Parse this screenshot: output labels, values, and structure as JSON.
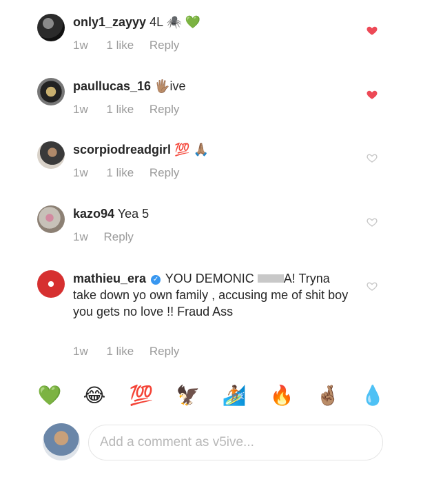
{
  "comments": [
    {
      "username": "only1_zayyy",
      "text": "4L 🕷️ 💚",
      "time": "1w",
      "likes": "1 like",
      "reply": "Reply",
      "liked": true
    },
    {
      "username": "paullucas_16",
      "text": "🖐🏽ive",
      "time": "1w",
      "likes": "1 like",
      "reply": "Reply",
      "liked": true
    },
    {
      "username": "scorpiodreadgirl",
      "text": "💯 🙏🏽",
      "time": "1w",
      "likes": "1 like",
      "reply": "Reply",
      "liked": false
    },
    {
      "username": "kazo94",
      "text": "Yea 5",
      "time": "1w",
      "likes": "",
      "reply": "Reply",
      "liked": false
    },
    {
      "username": "mathieu_era",
      "text_before": "YOU DEMONIC",
      "text_after": "A! Tryna take down yo own family , accusing me of shit boy you gets no love !! Fraud Ass",
      "time": "1w",
      "likes": "1 like",
      "reply": "Reply",
      "liked": false
    }
  ],
  "emoji_bar": [
    "💚",
    "😂",
    "💯",
    "🦅",
    "🏄🏽",
    "🔥",
    "🤞🏽",
    "💧"
  ],
  "composer": {
    "placeholder": "Add a comment as v5ive..."
  },
  "colors": {
    "heart_liked": "#ed4956",
    "heart_empty": "#c7c7c7",
    "meta_text": "#9a9a9a",
    "verified": "#3897f0"
  }
}
